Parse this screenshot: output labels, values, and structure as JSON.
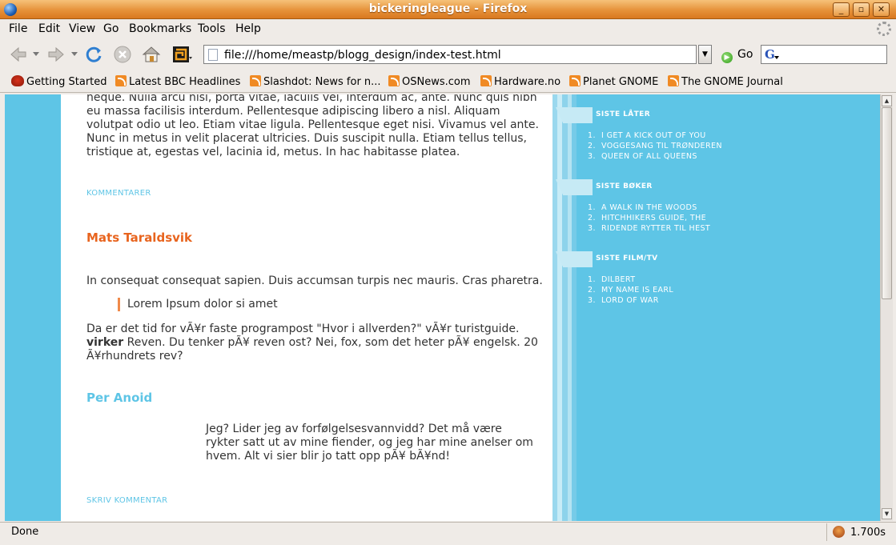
{
  "window": {
    "title": "bickeringleague - Firefox"
  },
  "menu": {
    "file": "File",
    "edit": "Edit",
    "view": "View",
    "go": "Go",
    "bookmarks": "Bookmarks",
    "tools": "Tools",
    "help": "Help"
  },
  "nav": {
    "url": "file:///home/meastp/blogg_design/index-test.html",
    "go_label": "Go",
    "search_value": ""
  },
  "bookmarks": [
    "Getting Started",
    "Latest BBC Headlines",
    "Slashdot: News for n...",
    "OSNews.com",
    "Hardware.no",
    "Planet GNOME",
    "The GNOME Journal"
  ],
  "page": {
    "para1": "neque. Nulla arcu nisi, porta vitae, iaculis vel, interdum ac, ante. Nunc quis nibh eu massa facilisis interdum. Pellentesque adipiscing libero a nisl. Aliquam volutpat odio ut leo. Etiam vitae ligula. Pellentesque eget nisi. Vivamus vel ante. Nunc in metus in velit placerat ultricies. Duis suscipit nulla. Etiam tellus tellus, tristique at, egestas vel, lacinia id, metus. In hac habitasse platea.",
    "comments_link": "KOMMENTARER",
    "author1": "Mats Taraldsvik",
    "author1_color": "#e8641e",
    "para2": "In consequat consequat sapien. Duis accumsan turpis nec mauris. Cras pharetra.",
    "quote": "Lorem Ipsum dolor si amet",
    "para3_start": "Da er det tid for vÃ¥r faste programpost \"Hvor i allverden?\" vÃ¥r turistguide.",
    "para3_bold": "virker",
    "para3_end": " Reven. Du tenker pÃ¥ reven ost? Nei, fox, som det heter pÃ¥ engelsk. 20 Ã¥rhundrets rev?",
    "author2": "Per Anoid",
    "author2_color": "#5ec5e6",
    "indent_text": "Jeg? Lider jeg av forfølgelsesvannvidd? Det må være rykter satt ut av mine fiender, og jeg har mine anelser om hvem. Alt vi sier blir jo tatt opp pÃ¥ bÃ¥nd!",
    "write_comment": "SKRIV KOMMENTAR"
  },
  "sidebar": {
    "sections": [
      {
        "title": "SISTE LÅTER",
        "items": [
          "I GET A KICK OUT OF YOU",
          "VOGGESANG TIL TRØNDEREN",
          "QUEEN OF ALL QUEENS"
        ]
      },
      {
        "title": "SISTE BØKER",
        "items": [
          "A WALK IN THE WOODS",
          "HITCHHIKERS GUIDE, THE",
          "RIDENDE RYTTER TIL HEST"
        ]
      },
      {
        "title": "SISTE FILM/TV",
        "items": [
          "DILBERT",
          "MY NAME IS EARL",
          "LORD OF WAR"
        ]
      }
    ],
    "numbers": [
      "1.",
      "2.",
      "3."
    ]
  },
  "status": {
    "text": "Done",
    "timer": "1.700s"
  },
  "colors": {
    "accent_blue": "#5ec5e6",
    "accent_orange": "#e8641e",
    "titlebar": "#e6923a"
  }
}
